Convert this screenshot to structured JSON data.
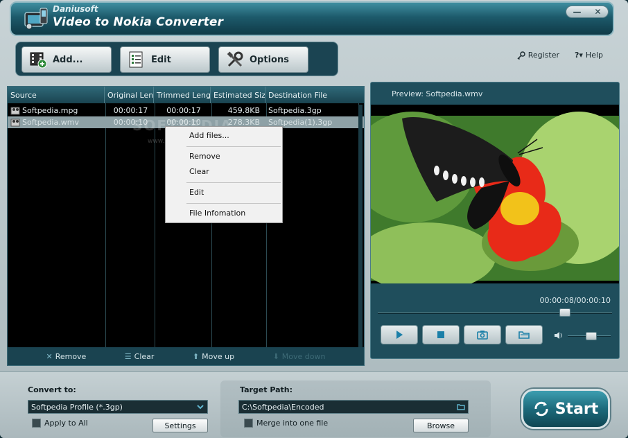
{
  "window": {
    "brand": "Daniusoft",
    "title": "Video to Nokia Converter",
    "minimize_glyph": "—",
    "close_glyph": "✕"
  },
  "toolbar": {
    "add_label": "Add...",
    "edit_label": "Edit",
    "options_label": "Options"
  },
  "toplinks": {
    "register": "Register",
    "help": "Help"
  },
  "file_list": {
    "columns": [
      "Source",
      "Original Len...",
      "Trimmed Length",
      "Estimated Size",
      "Destination File"
    ],
    "rows": [
      {
        "source": "Softpedia.mpg",
        "original": "00:00:17",
        "trimmed": "00:00:17",
        "size": "459.8KB",
        "dest": "Softpedia.3gp",
        "selected": false
      },
      {
        "source": "Softpedia.wmv",
        "original": "00:00:10",
        "trimmed": "00:00:10",
        "size": "278.3KB",
        "dest": "Softpedia(1).3gp",
        "selected": true
      }
    ],
    "watermark": "SOFTPEDIA",
    "watermark_url": "www.softpedia.com"
  },
  "list_footer": {
    "remove": "Remove",
    "clear": "Clear",
    "move_up": "Move up",
    "move_down": "Move down"
  },
  "context_menu": {
    "add_files": "Add files...",
    "remove": "Remove",
    "clear": "Clear",
    "edit": "Edit",
    "file_info": "File Infomation"
  },
  "preview": {
    "title": "Preview: Softpedia.wmv",
    "timecode": "00:00:08/00:00:10",
    "seek_progress": 0.8,
    "volume": 0.55
  },
  "bottom": {
    "convert_to_label": "Convert to:",
    "profile_value": "Softpedia Profile (*.3gp)",
    "apply_to_all": "Apply to All",
    "settings": "Settings",
    "target_path_label": "Target Path:",
    "target_path_value": "C:\\Softpedia\\Encoded",
    "merge_label": "Merge into one file",
    "browse": "Browse",
    "start": "Start"
  },
  "colors": {
    "accent": "#1c6a7b",
    "panel_bg": "#1f4e5c",
    "list_bg": "#000000",
    "selected_row": "#8ea1a6"
  }
}
